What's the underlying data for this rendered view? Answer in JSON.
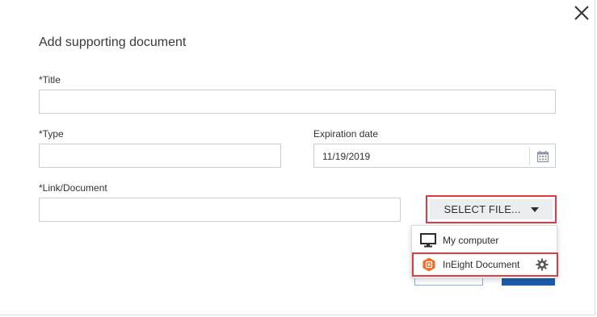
{
  "dialog": {
    "title": "Add supporting document",
    "close_icon": "close-icon"
  },
  "fields": {
    "title_label": "*Title",
    "title_value": "",
    "type_label": "*Type",
    "type_value": "",
    "expiration_label": "Expiration date",
    "expiration_value": "11/19/2019",
    "link_label": "*Link/Document",
    "link_value": ""
  },
  "select_file": {
    "label": "SELECT FILE...",
    "icon": "caret-down-icon",
    "highlight_color": "#e03a3e"
  },
  "dropdown": {
    "items": [
      {
        "label": "My computer",
        "icon": "monitor-icon"
      },
      {
        "label": "InEight Document",
        "icon": "ineight-hex-icon",
        "trailing_icon": "gear-icon"
      }
    ]
  },
  "colors": {
    "brand_orange": "#f26b21",
    "primary_blue": "#1b5dab",
    "highlight_red": "#e03a3e"
  }
}
